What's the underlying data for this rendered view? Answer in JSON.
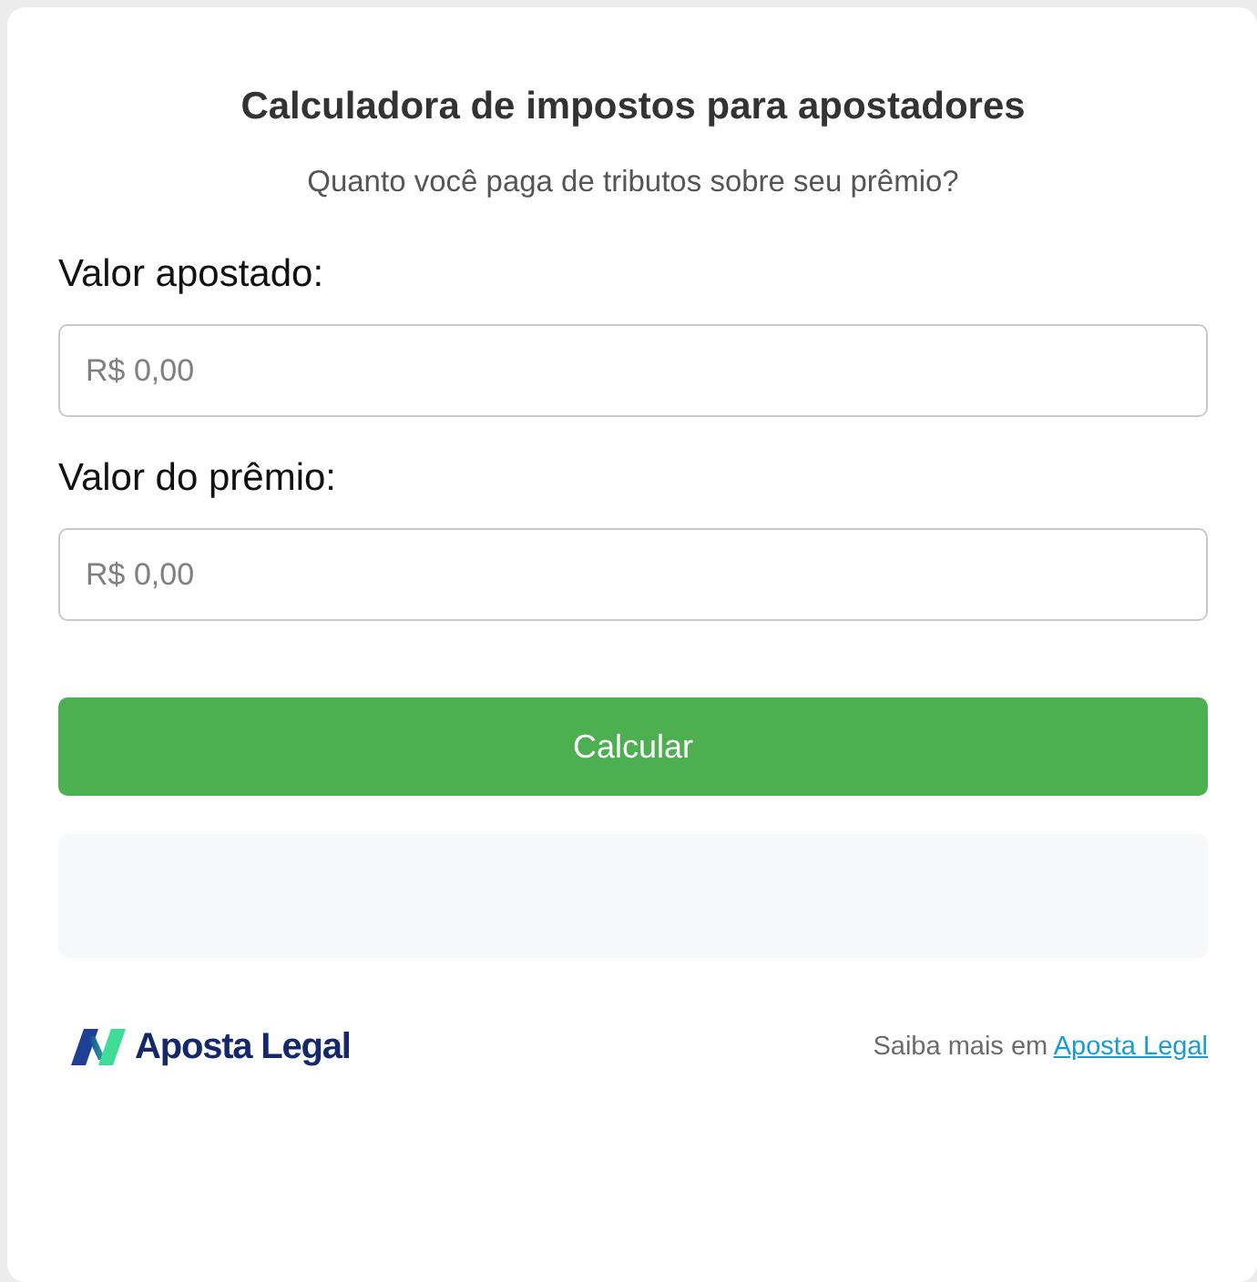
{
  "header": {
    "title": "Calculadora de impostos para apostadores",
    "subtitle": "Quanto você paga de tributos sobre seu prêmio?"
  },
  "fields": [
    {
      "label": "Valor apostado:",
      "placeholder": "R$ 0,00"
    },
    {
      "label": "Valor do prêmio:",
      "placeholder": "R$ 0,00"
    }
  ],
  "button": {
    "label": "Calcular"
  },
  "footer": {
    "logo_text": "Aposta Legal",
    "note": "Saiba mais em",
    "link": "Aposta Legal"
  }
}
